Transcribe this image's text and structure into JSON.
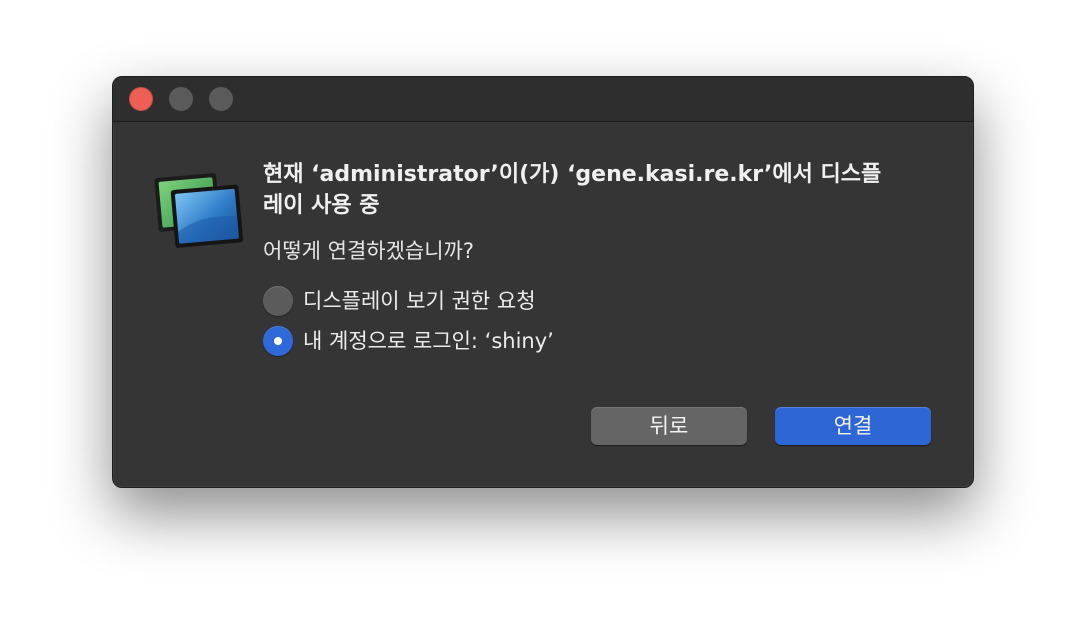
{
  "dialog": {
    "heading": "현재 ‘administrator’이(가) ‘gene.kasi.re.kr’에서 디스플\n레이 사용 중",
    "question": "어떻게 연결하겠습니까?",
    "app_icon": "screen-sharing-icon",
    "options": [
      {
        "label": "디스플레이 보기 권한 요청",
        "selected": false
      },
      {
        "label": "내 계정으로 로그인: ‘shiny’",
        "selected": true
      }
    ],
    "buttons": {
      "back": "뒤로",
      "connect": "연결"
    }
  },
  "colors": {
    "window_bg": "#353535",
    "titlebar_bg": "#2e2e2e",
    "close_button": "#ed5e55",
    "accent": "#2f66d6",
    "secondary_button": "#656565"
  }
}
